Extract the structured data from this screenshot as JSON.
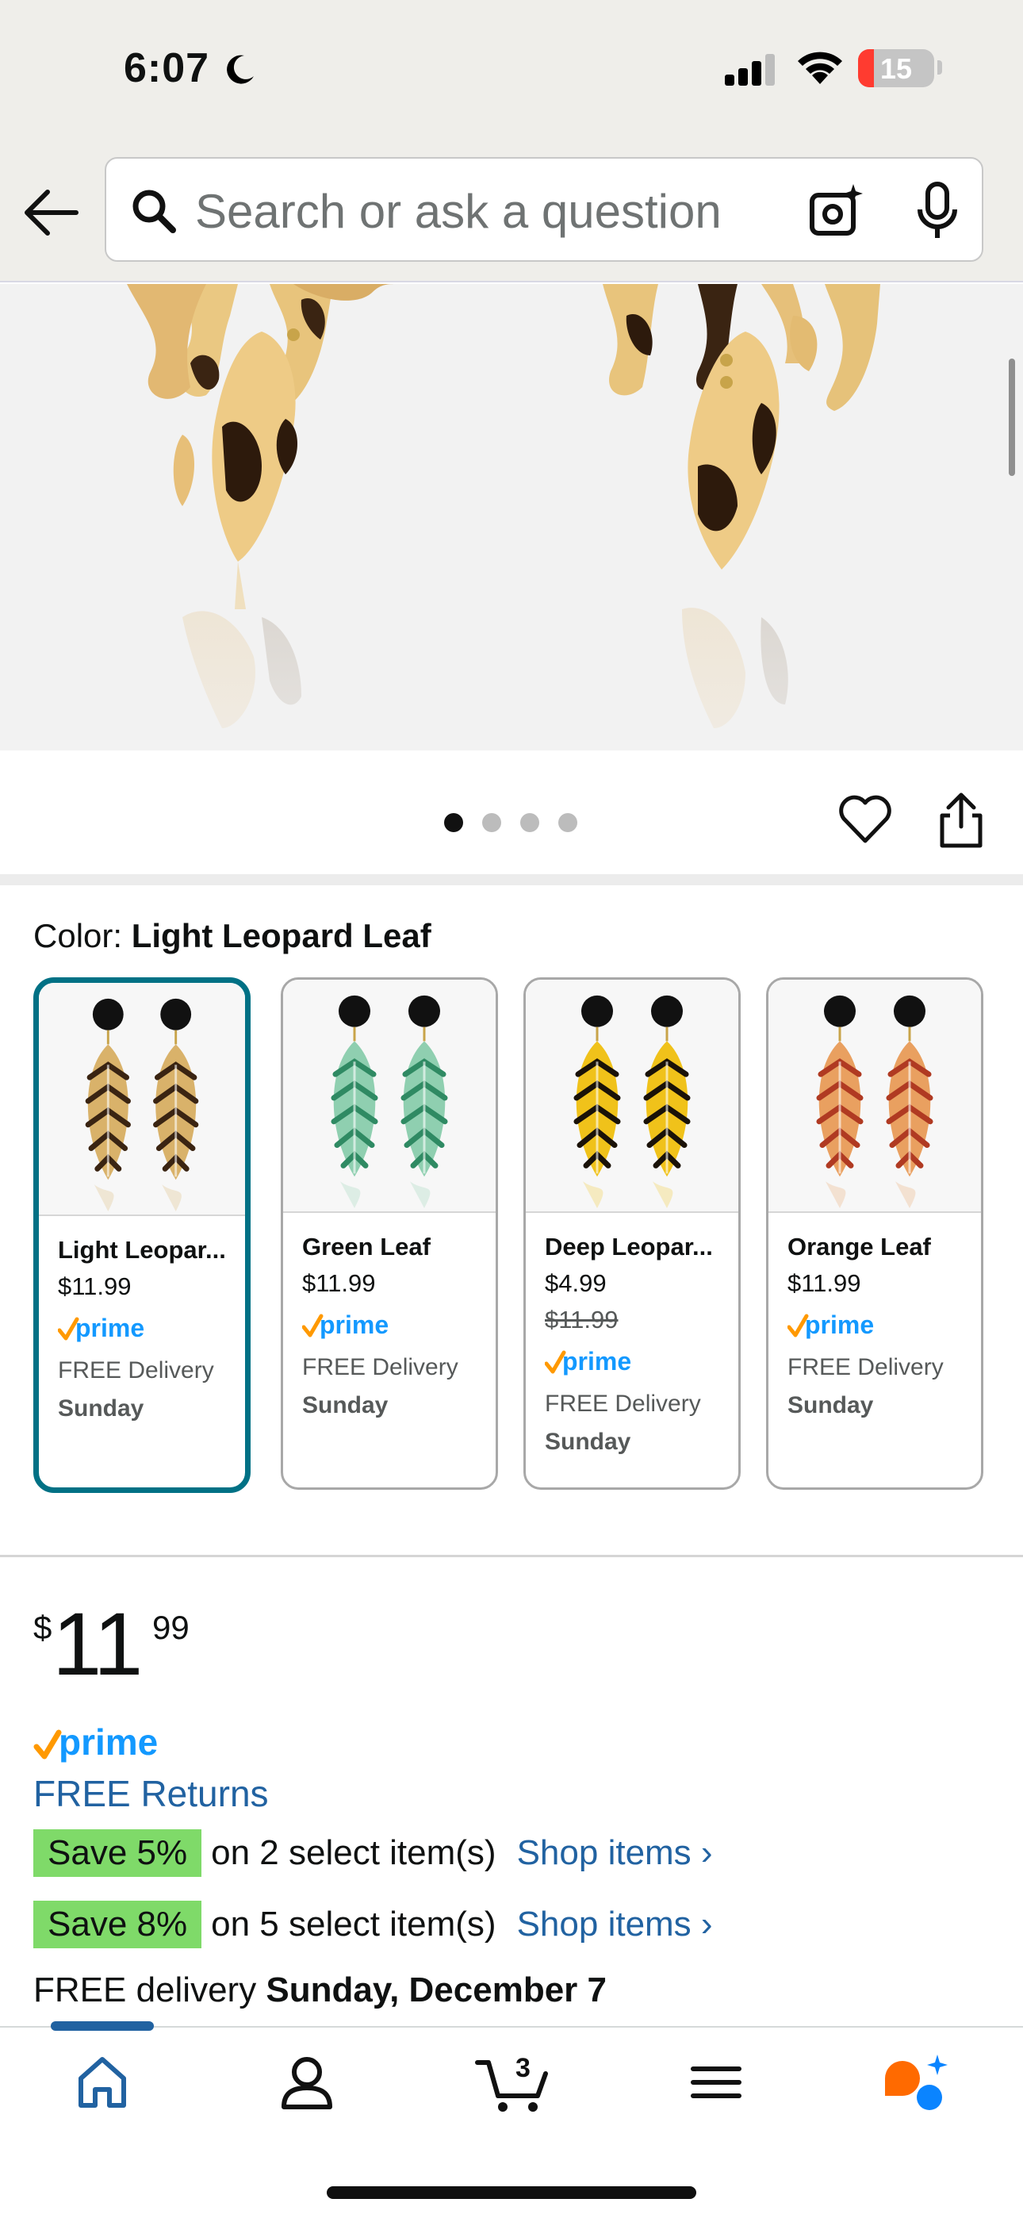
{
  "status_bar": {
    "time": "6:07",
    "battery_level": "15",
    "icons": [
      "moon-icon",
      "cellular-signal-icon",
      "wifi-icon",
      "battery-icon"
    ]
  },
  "header": {
    "back_icon": "arrow-left-icon",
    "search": {
      "placeholder": "Search or ask a question",
      "value": ""
    },
    "icons": [
      "search-icon",
      "camera-sparkle-icon",
      "microphone-icon"
    ]
  },
  "gallery": {
    "image_count": 4,
    "active_index": 0,
    "actions": [
      "heart-icon",
      "share-icon"
    ]
  },
  "variations": {
    "label": "Color:",
    "selected": "Light Leopard Leaf",
    "items": [
      {
        "name": "Light Leopar...",
        "price": "$11.99",
        "list_price": "",
        "prime": "prime",
        "delivery": "FREE Delivery",
        "day": "Sunday",
        "selected": true,
        "leaf_color": "#d9b26a",
        "spot_color": "#3a2412"
      },
      {
        "name": "Green Leaf",
        "price": "$11.99",
        "list_price": "",
        "prime": "prime",
        "delivery": "FREE Delivery",
        "day": "Sunday",
        "selected": false,
        "leaf_color": "#8fcfb0",
        "spot_color": "#2f8a63"
      },
      {
        "name": "Deep Leopar...",
        "price": "$4.99",
        "list_price": "$11.99",
        "prime": "prime",
        "delivery": "FREE Delivery",
        "day": "Sunday",
        "selected": false,
        "leaf_color": "#f0c21a",
        "spot_color": "#1a1208"
      },
      {
        "name": "Orange Leaf",
        "price": "$11.99",
        "list_price": "",
        "prime": "prime",
        "delivery": "FREE Delivery",
        "day": "Sunday",
        "selected": false,
        "leaf_color": "#e9a060",
        "spot_color": "#b03a22"
      }
    ]
  },
  "buybox": {
    "price_symbol": "$",
    "price_whole": "11",
    "price_fraction": "99",
    "prime": "prime",
    "free_returns": "FREE Returns",
    "promos": [
      {
        "badge": "Save 5%",
        "text": "on 2 select item(s)",
        "link": "Shop items ›"
      },
      {
        "badge": "Save 8%",
        "text": "on 5 select item(s)",
        "link": "Shop items ›"
      }
    ],
    "delivery_prefix": "FREE delivery",
    "delivery_date": "Sunday, December 7"
  },
  "bottom_nav": {
    "cart_count": "3",
    "items": [
      "home-icon",
      "account-icon",
      "cart-icon",
      "menu-icon",
      "rufus-assistant-icon"
    ],
    "active": "home-icon"
  },
  "colors": {
    "link": "#2162a1",
    "selected_border": "#007185",
    "prime_blue": "#1399ff",
    "prime_check": "#ff9900",
    "save_badge": "#7fda69"
  }
}
